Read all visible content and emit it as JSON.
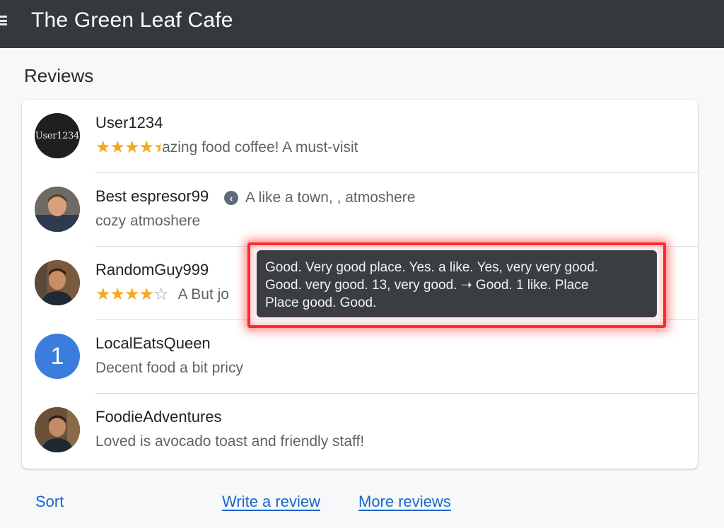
{
  "app": {
    "title": "The Green Leaf Cafe"
  },
  "section": {
    "title": "Reviews"
  },
  "reviews": [
    {
      "name": "User1234",
      "avatar_text": "User1234",
      "rating_stars": 4.5,
      "stars": "★★★★",
      "half": "★",
      "text": "azing food coffee! A must-visit"
    },
    {
      "name": "Best espresor99",
      "extra": "A like a town, , atmoshere",
      "text": "cozy atmoshere",
      "badge_icon": "info-icon"
    },
    {
      "name": "RandomGuy999",
      "rating_stars": 4.5,
      "stars": "★★★★",
      "half": "☆",
      "text": "A But jo"
    },
    {
      "name": "LocalEatsQueen",
      "avatar_initial": "1",
      "text": "Decent food a bit pricy"
    },
    {
      "name": "FoodieAdventures",
      "text": "Loved is avocado toast and friendly staff!"
    }
  ],
  "tooltip": {
    "lines": [
      "Good. Very good place. Yes. a like. Yes, very very good.",
      "Good. very good. 13, very  good. ➝ Good. 1 like. Place",
      "Place good. Good."
    ]
  },
  "footer": {
    "sort_label": "Sort",
    "write_review_label": "Write a review",
    "more_reviews_label": "More reviews"
  },
  "colors": {
    "appbar": "#35393e",
    "star": "#f4a91c",
    "link": "#1a66c9",
    "highlight": "#ff2a2a",
    "avatar_initial_bg": "#3b7ddd"
  }
}
